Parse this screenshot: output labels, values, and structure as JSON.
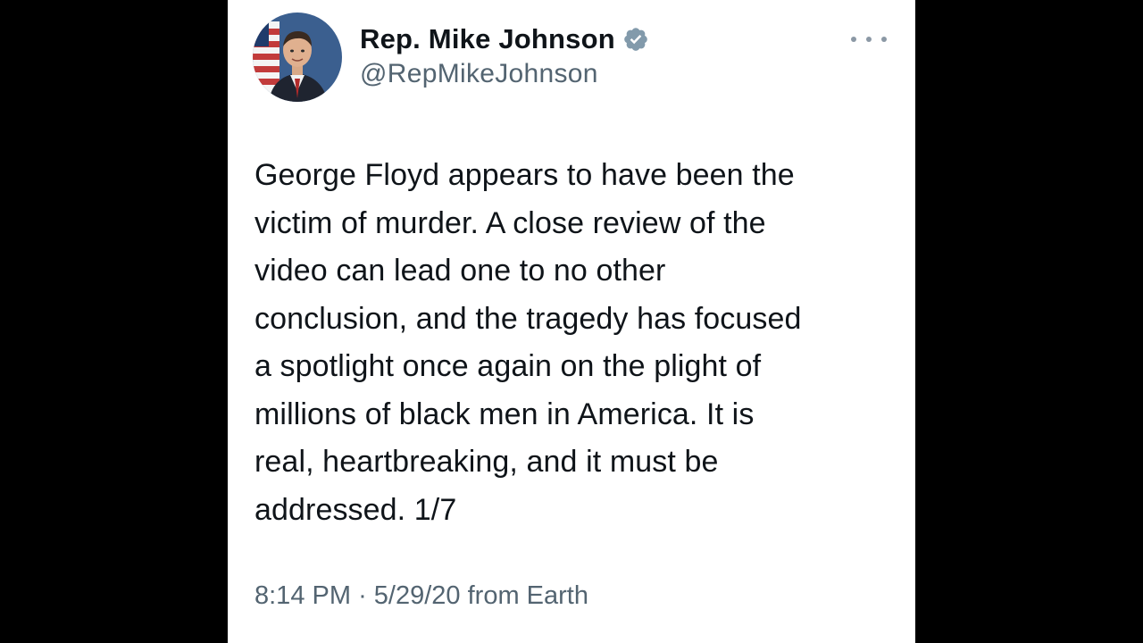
{
  "author": {
    "display_name": "Rep. Mike Johnson",
    "handle": "@RepMikeJohnson",
    "verified_icon": "verified-badge-icon",
    "verified_color": "#829aab"
  },
  "tweet": {
    "lines": [
      "George Floyd appears to have been the",
      "victim of murder. A close review of the",
      "video can lead one to no other",
      "conclusion, and the tragedy has focused",
      "a spotlight once again on the plight of",
      "millions of black men in America. It is",
      "real, heartbreaking, and it must be",
      "addressed. 1/7"
    ],
    "time": "8:14 PM",
    "separator": "·",
    "date": "5/29/20",
    "source": "from Earth"
  },
  "colors": {
    "text_primary": "#0f1419",
    "text_secondary": "#536471",
    "background": "#ffffff",
    "letterbox": "#000000"
  }
}
